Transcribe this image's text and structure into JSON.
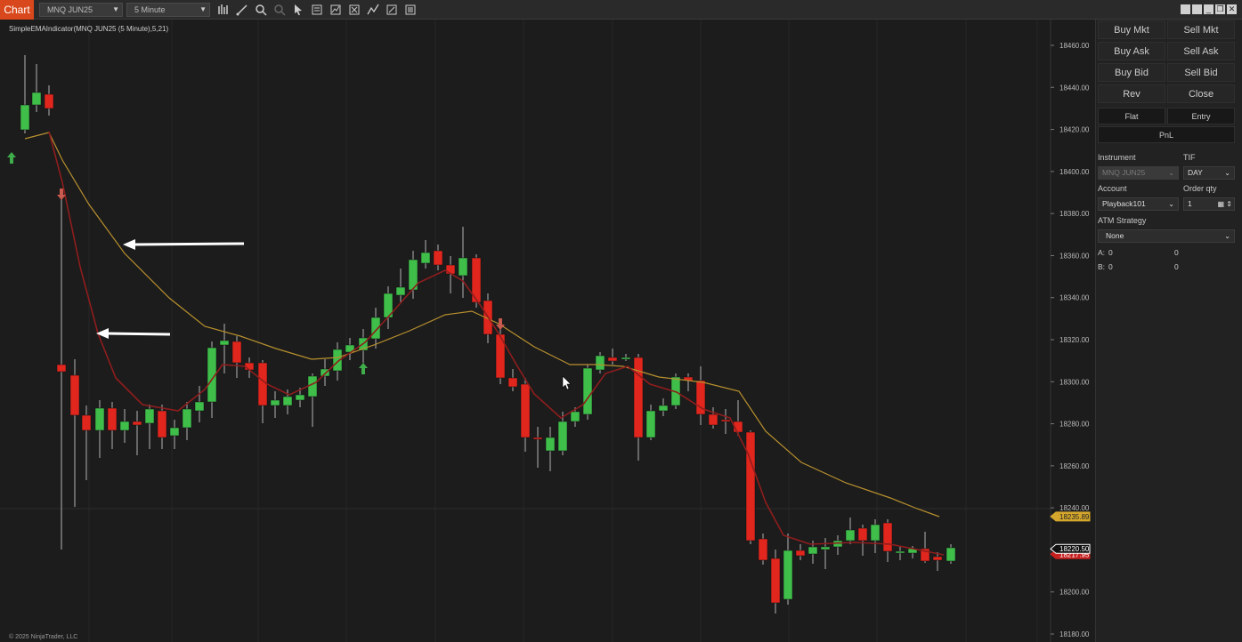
{
  "toolbar": {
    "chart_tab": "Chart",
    "instrument": "MNQ JUN25",
    "interval": "5 Minute",
    "icons": [
      "bar-type-icon",
      "draw-line-icon",
      "zoom-icon",
      "zoom-out-icon",
      "pointer-icon",
      "data-box-icon",
      "indicators-icon",
      "strategies-icon",
      "draw-tools-icon",
      "properties-icon",
      "template-icon"
    ]
  },
  "chart": {
    "indicator_label": "SimpleEMAIndicator(MNQ JUN25 (5 Minute),5,21)",
    "copyright": "© 2025 NinjaTrader, LLC",
    "y_ticks": [
      "18460.00",
      "18440.00",
      "18420.00",
      "18400.00",
      "18380.00",
      "18360.00",
      "18340.00",
      "18320.00",
      "18300.00",
      "18280.00",
      "18260.00",
      "18240.00",
      "18220.00",
      "18200.00",
      "18180.00"
    ],
    "price_markers": {
      "ema_slow": "18235.89",
      "last": "18220.50",
      "ema_fast": "18217.95"
    },
    "colors": {
      "up": "#3fbe4a",
      "down": "#e0261d",
      "ema_fast": "#8f1d1d",
      "ema_slow": "#b8902e",
      "marker_last": "#ffffff",
      "marker_slow": "#d4a72c",
      "marker_fast": "#c72020"
    }
  },
  "panel": {
    "buttons": [
      [
        "Buy Mkt",
        "Sell Mkt"
      ],
      [
        "Buy Ask",
        "Sell Ask"
      ],
      [
        "Buy Bid",
        "Sell Bid"
      ],
      [
        "Rev",
        "Close"
      ]
    ],
    "flat": "Flat",
    "entry": "Entry",
    "pnl": "PnL",
    "instrument_label": "Instrument",
    "instrument_value": "MNQ JUN25",
    "tif_label": "TIF",
    "tif_value": "DAY",
    "account_label": "Account",
    "account_value": "Playback101",
    "order_qty_label": "Order qty",
    "order_qty_value": "1",
    "atm_label": "ATM Strategy",
    "atm_value": "None",
    "a_label": "A:",
    "a_val1": "0",
    "a_val2": "0",
    "b_label": "B:",
    "b_val1": "0",
    "b_val2": "0"
  }
}
